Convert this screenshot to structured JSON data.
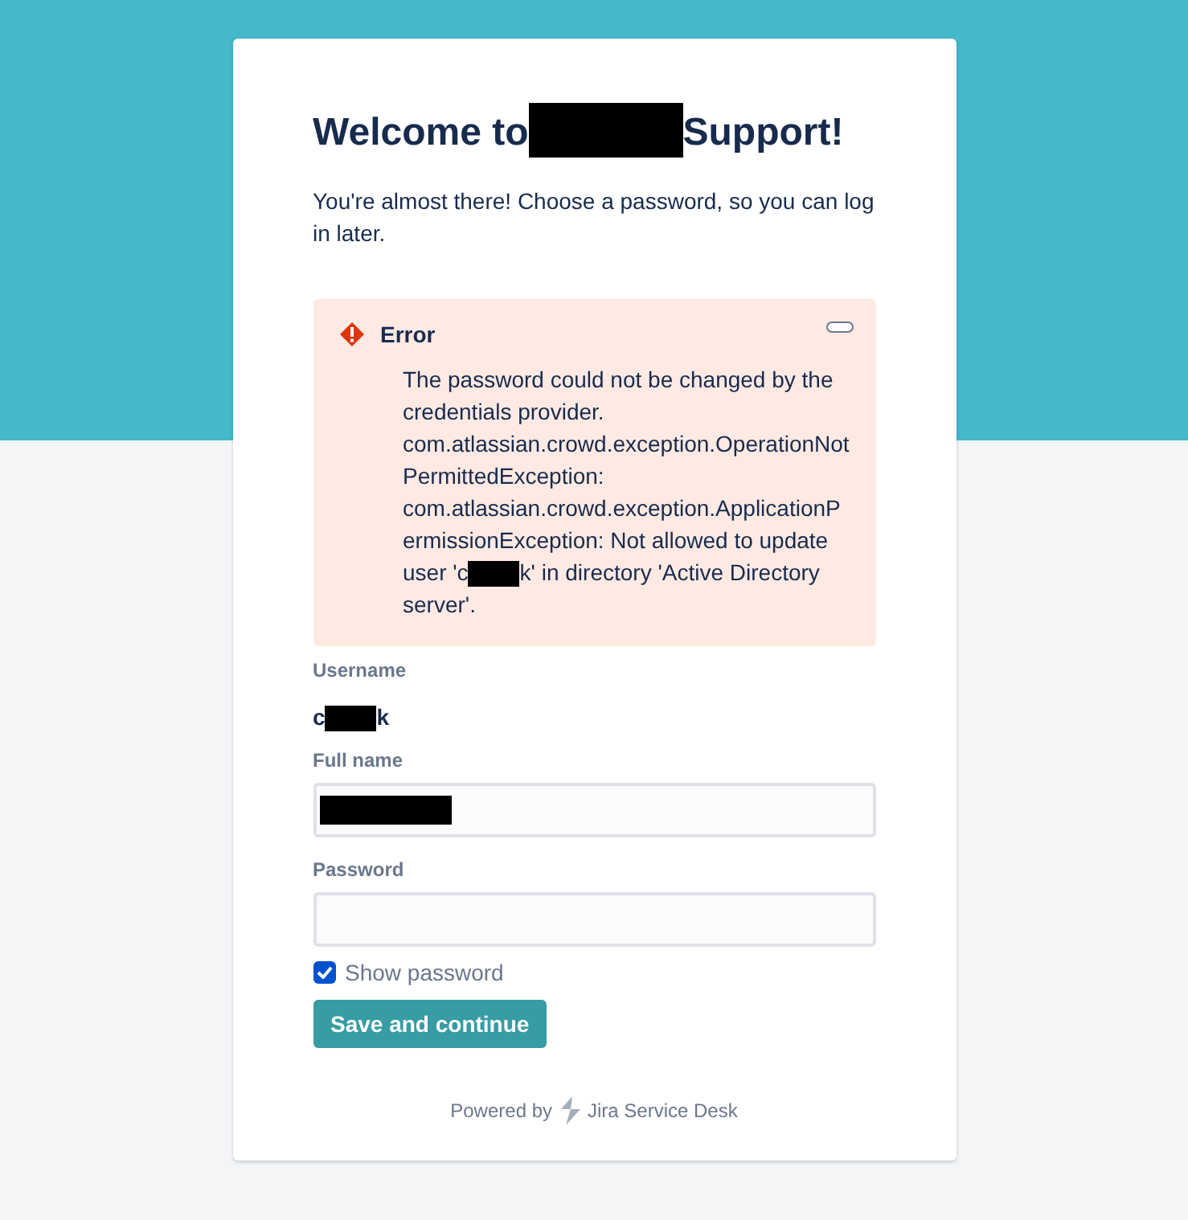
{
  "title": [
    {
      "kind": "text",
      "text": "Welcome to"
    },
    {
      "kind": "redacted"
    },
    {
      "kind": "text",
      "text": "Support!"
    }
  ],
  "intro": "You're almost there! Choose a password, so you can log in later.",
  "error": {
    "title": "Error",
    "expanded": true,
    "message": [
      {
        "kind": "text",
        "text": "The password could not be changed by the credentials provider. com.atlassian.crowd.exception.OperationNotPermittedException: com.atlassian.crowd.exception.ApplicationPermissionException: Not allowed to update user 'c"
      },
      {
        "kind": "redacted"
      },
      {
        "kind": "text",
        "text": "k' in directory 'Active Directory server'."
      }
    ]
  },
  "username": {
    "label": "Username",
    "value": [
      {
        "kind": "text",
        "text": "c"
      },
      {
        "kind": "redacted"
      },
      {
        "kind": "text",
        "text": "k"
      }
    ]
  },
  "full_name": {
    "label": "Full name",
    "value": [
      {
        "kind": "redacted"
      }
    ]
  },
  "password": {
    "label": "Password"
  },
  "show_password": {
    "label": "Show password",
    "checked": true
  },
  "submit": "Save and continue",
  "footer": {
    "prefix": "Powered by",
    "product": "Jira Service Desk"
  }
}
